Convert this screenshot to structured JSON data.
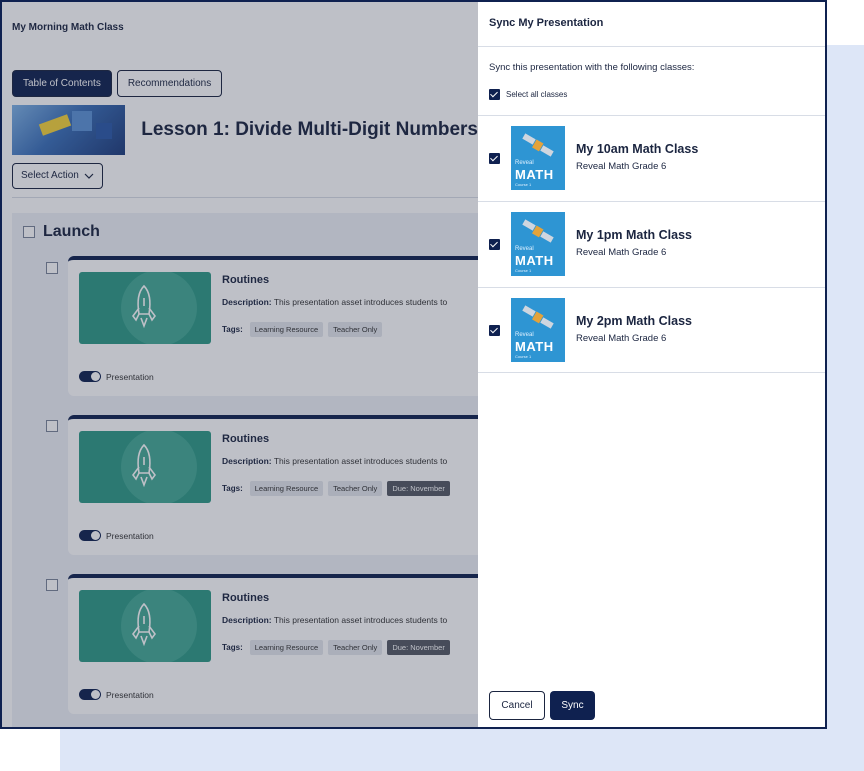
{
  "page": {
    "class_title": "My Morning Math Class",
    "tabs": [
      {
        "label": "Table of Contents",
        "active": true
      },
      {
        "label": "Recommendations",
        "active": false
      }
    ],
    "lesson_title": "Lesson 1: Divide Multi-Digit Numbers",
    "select_action_label": "Select Action",
    "section_title": "Launch",
    "cards": [
      {
        "title": "Routines",
        "desc_label": "Description:",
        "desc_text": "This presentation asset introduces students to",
        "tags_label": "Tags:",
        "tags": [
          "Learning Resource",
          "Teacher Only"
        ],
        "due": "",
        "toggle_label": "Presentation"
      },
      {
        "title": "Routines",
        "desc_label": "Description:",
        "desc_text": "This presentation asset introduces students to",
        "tags_label": "Tags:",
        "tags": [
          "Learning Resource",
          "Teacher Only"
        ],
        "due": "Due: November",
        "toggle_label": "Presentation"
      },
      {
        "title": "Routines",
        "desc_label": "Description:",
        "desc_text": "This presentation asset introduces students to",
        "tags_label": "Tags:",
        "tags": [
          "Learning Resource",
          "Teacher Only"
        ],
        "due": "Due: November",
        "toggle_label": "Presentation"
      }
    ]
  },
  "panel": {
    "title": "Sync My Presentation",
    "subtitle": "Sync this presentation with the following classes:",
    "select_all_label": "Select all classes",
    "classes": [
      {
        "name": "My 10am Math Class",
        "course": "Reveal Math Grade 6",
        "checked": true
      },
      {
        "name": "My 1pm Math Class",
        "course": "Reveal Math Grade 6",
        "checked": true
      },
      {
        "name": "My 2pm Math Class",
        "course": "Reveal Math Grade 6",
        "checked": true
      }
    ],
    "thumb": {
      "reveal": "Reveal",
      "math": "MATH",
      "course": "Course 1"
    },
    "cancel_label": "Cancel",
    "sync_label": "Sync"
  },
  "colors": {
    "navy": "#0f2150",
    "teal": "#2f9a86",
    "backdrop": "#dde6f7",
    "thumb_blue": "#2e95d3"
  }
}
